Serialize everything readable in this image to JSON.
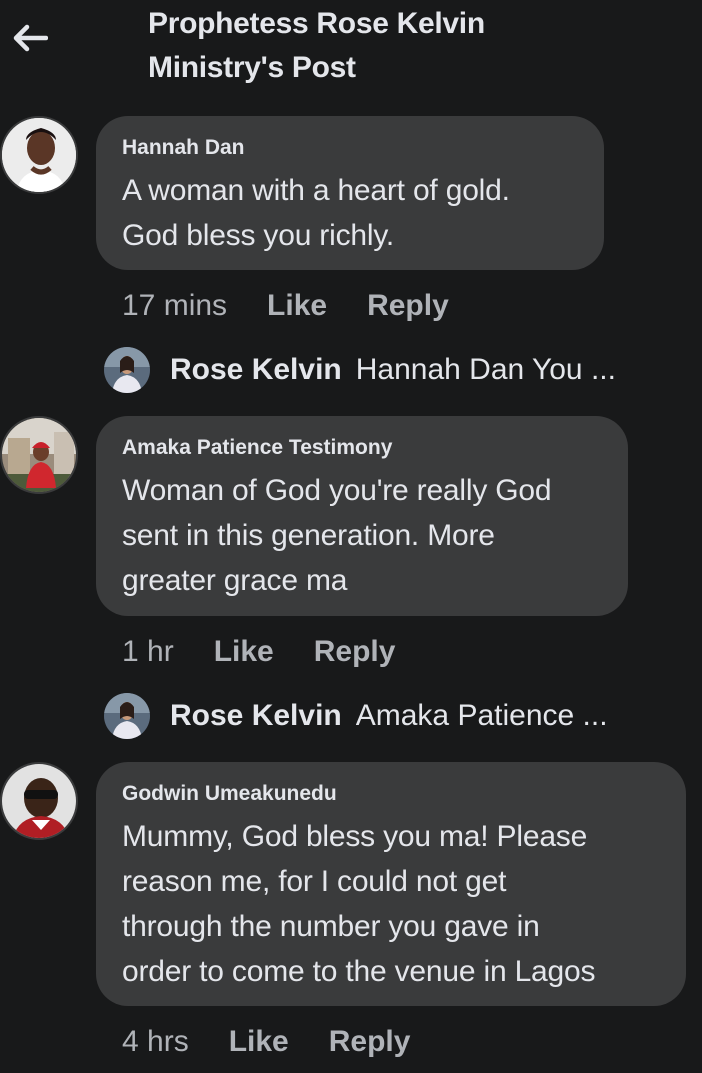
{
  "header": {
    "title_line1": "Prophetess Rose Kelvin",
    "title_line2": "Ministry's Post"
  },
  "comments": [
    {
      "author": "Hannah Dan",
      "lines": [
        "A woman with a heart of gold.",
        "God bless you richly."
      ],
      "time": "17 mins",
      "like_label": "Like",
      "reply_label": "Reply",
      "reply_preview": {
        "name": "Rose Kelvin",
        "text": "Hannah Dan You ..."
      }
    },
    {
      "author": "Amaka Patience Testimony",
      "lines": [
        "Woman of God you're really God",
        "sent in this generation. More",
        "greater grace ma"
      ],
      "time": "1 hr",
      "like_label": "Like",
      "reply_label": "Reply",
      "reply_preview": {
        "name": "Rose Kelvin",
        "text": "Amaka Patience ..."
      }
    },
    {
      "author": "Godwin Umeakunedu",
      "lines": [
        "Mummy, God bless you ma! Please",
        "reason me, for I could not get",
        "through the number you gave in",
        "order to come to the venue in Lagos"
      ],
      "time": "4 hrs",
      "like_label": "Like",
      "reply_label": "Reply"
    }
  ],
  "colors": {
    "background": "#18191a",
    "bubble": "#3a3b3c",
    "text_primary": "#e4e6eb",
    "text_secondary": "#b0b3b8"
  },
  "icons": {
    "back": "back-arrow-icon"
  }
}
